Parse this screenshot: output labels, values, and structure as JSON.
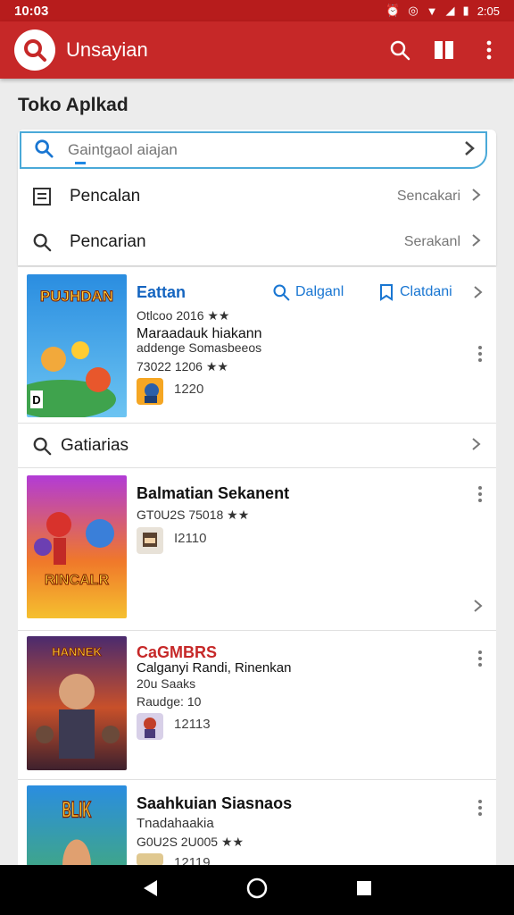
{
  "status": {
    "time": "10:03",
    "battery": "2:05"
  },
  "appbar": {
    "title": "Unsayian"
  },
  "page": {
    "title": "Toko Aplkad"
  },
  "search": {
    "placeholder": "Gaintgaol aiajan"
  },
  "rows": [
    {
      "label": "Pencalan",
      "hint": "Sencakari"
    },
    {
      "label": "Pencarian",
      "hint": "Serakanl"
    }
  ],
  "featured": {
    "title": "Eattan",
    "action1": "Dalganl",
    "action2": "Clatdani",
    "meta": "Otlcoo 2016 ★★",
    "line1": "Maraadauk hiakann",
    "line2": "addenge Somasbeeos",
    "rating": "73022 1206 ★★",
    "thumb_text": "1220",
    "cover_text": "PUJHDAN",
    "cover_badge": "D"
  },
  "section": {
    "label": "Gatiarias"
  },
  "items": [
    {
      "title": "Balmatian Sekanent",
      "meta": "GT0U2S 75018 ★★",
      "thumb_text": "I2110",
      "cover_text": "RINCALR"
    },
    {
      "title": "CaGMBRS",
      "line1": "Calganyi Randi, Rinenkan",
      "line2": "20u Saaks",
      "meta": "Raudge: 10",
      "thumb_text": "12113",
      "cover_text": "HANNEK"
    },
    {
      "title": "Saahkuian Siasnaos",
      "line1": "Tnadahaakia",
      "meta": "G0U2S 2U005 ★★",
      "thumb_text": "12119",
      "cover_text": "BLIK"
    }
  ],
  "colors": {
    "brand": "#c62828",
    "accent": "#1976d2"
  }
}
